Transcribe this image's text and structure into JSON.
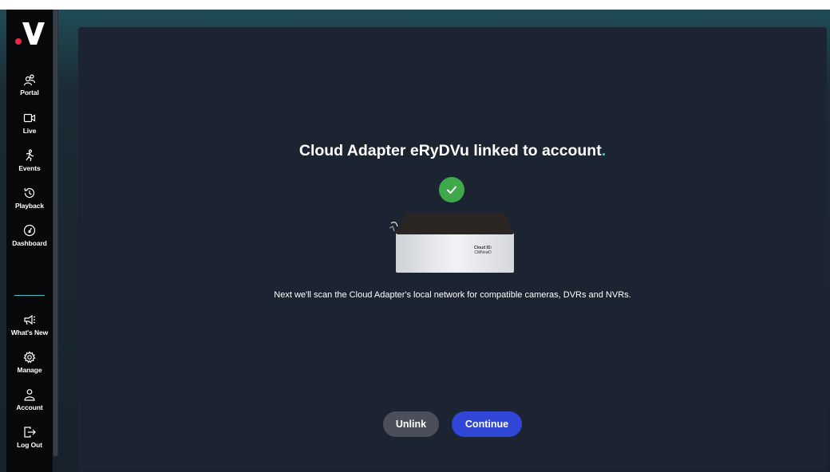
{
  "brand": {
    "logo_text": "V",
    "dot_color": "#e8254b"
  },
  "sidebar": {
    "items": [
      {
        "label": "Portal",
        "icon": "users-icon"
      },
      {
        "label": "Live",
        "icon": "video-camera-icon"
      },
      {
        "label": "Events",
        "icon": "running-person-icon"
      },
      {
        "label": "Playback",
        "icon": "history-icon"
      },
      {
        "label": "Dashboard",
        "icon": "gauge-icon"
      }
    ],
    "bottom_items": [
      {
        "label": "What's New",
        "icon": "megaphone-icon"
      },
      {
        "label": "Manage",
        "icon": "gear-icon"
      },
      {
        "label": "Account",
        "icon": "person-icon"
      },
      {
        "label": "Log Out",
        "icon": "logout-icon"
      }
    ]
  },
  "main": {
    "title": "Cloud Adapter eRyDVu linked to account",
    "title_dot": ".",
    "device": {
      "label_title": "Cloud ID:",
      "label_value": "CMNnwD"
    },
    "description": "Next we'll scan the Cloud Adapter's local network for compatible cameras, DVRs and NVRs.",
    "unlink_label": "Unlink",
    "continue_label": "Continue"
  },
  "colors": {
    "accent": "#3cc2c7",
    "success": "#3fa84b",
    "primary_button": "#2f46d6",
    "secondary_button": "#4a4f59",
    "panel": "#1d2431",
    "sidebar": "#070809"
  }
}
